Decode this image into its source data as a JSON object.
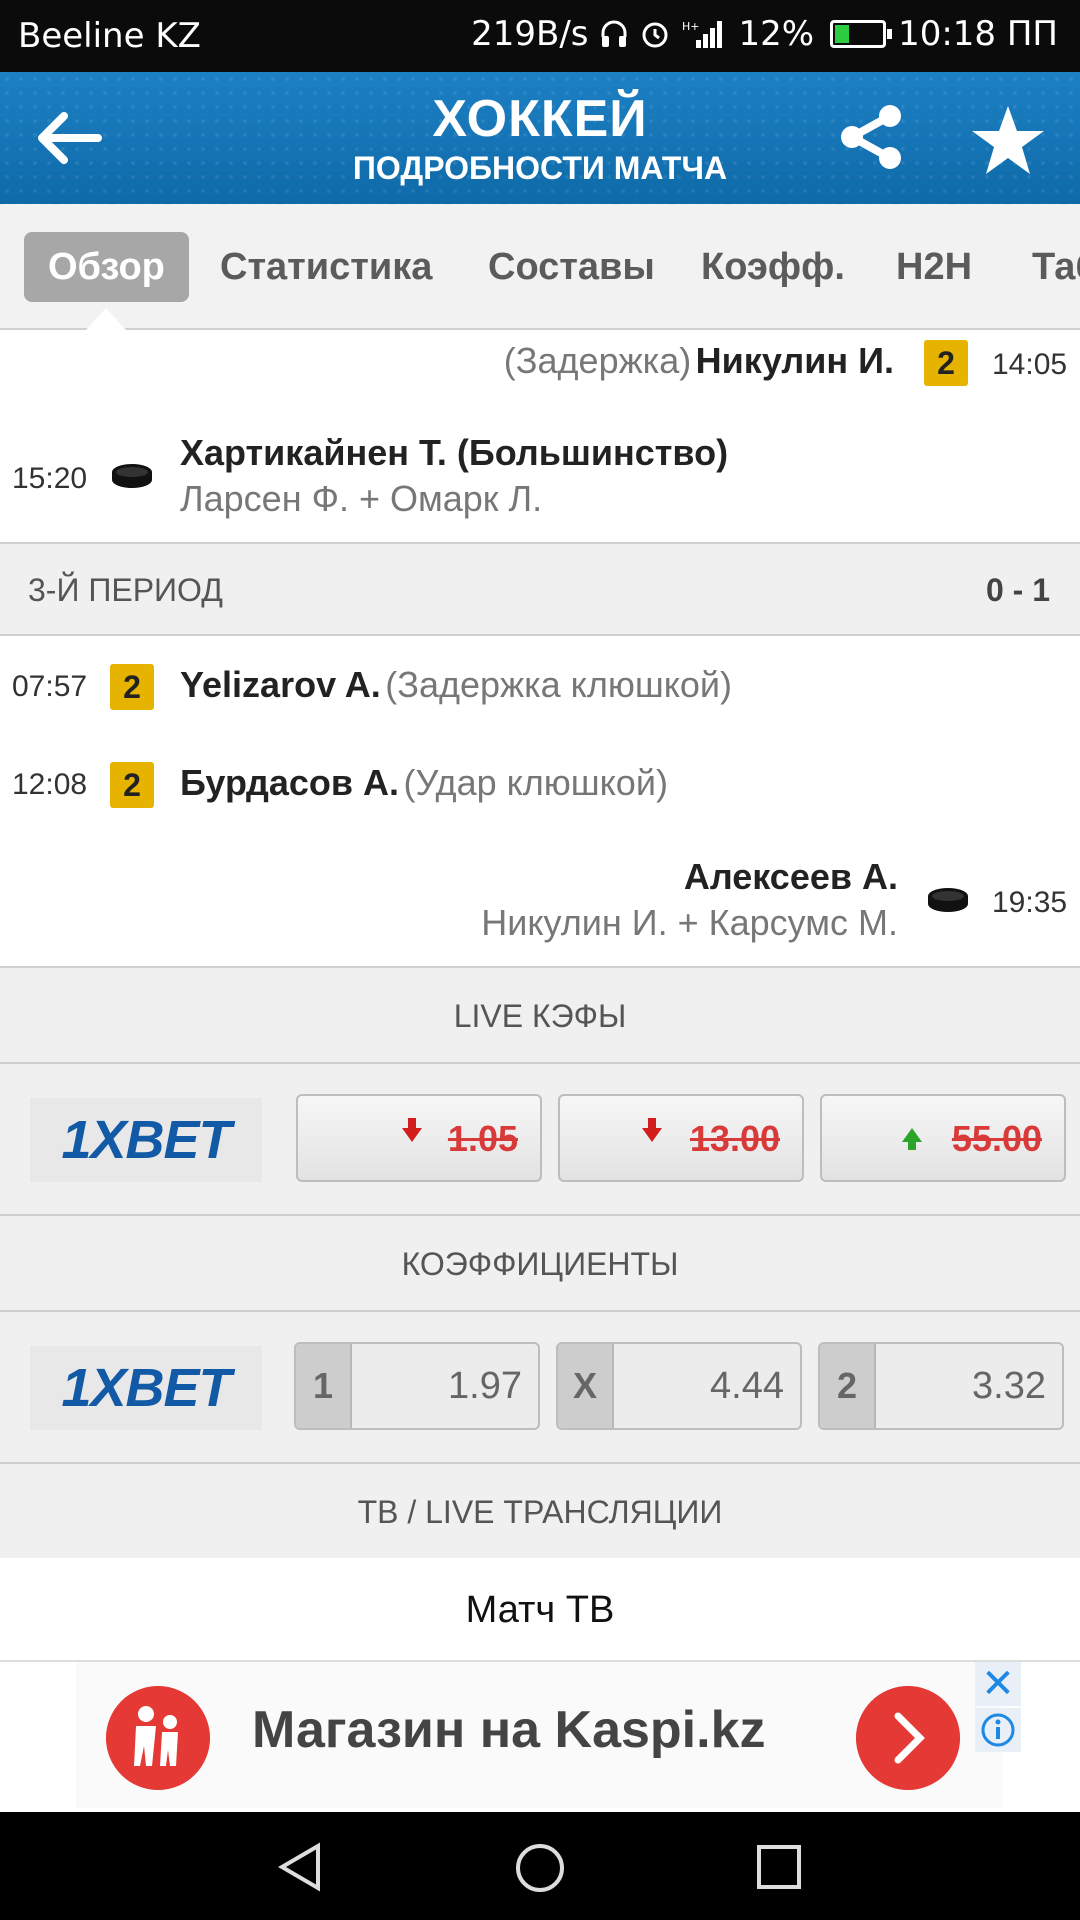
{
  "status_bar": {
    "carrier": "Beeline KZ",
    "speed": "219B/s",
    "battery_pct": "12%",
    "time": "10:18 ПП"
  },
  "app_bar": {
    "title": "ХОККЕЙ",
    "subtitle": "ПОДРОБНОСТИ МАТЧА"
  },
  "tabs": [
    {
      "label": "Обзор",
      "active": true
    },
    {
      "label": "Статистика"
    },
    {
      "label": "Составы"
    },
    {
      "label": "Коэфф."
    },
    {
      "label": "H2H"
    },
    {
      "label": "Таб"
    }
  ],
  "events_top": [
    {
      "detail": "(Задержка)",
      "player": "Никулин И.",
      "card": "2",
      "time": "14:05"
    },
    {
      "time": "15:20",
      "player": "Хартикайнен Т. (Большинство)",
      "assists": "Ларсен Ф. + Омарк Л."
    }
  ],
  "period3": {
    "label": "3-Й ПЕРИОД",
    "score": "0 - 1",
    "events": [
      {
        "time": "07:57",
        "card": "2",
        "player": "Yelizarov A.",
        "detail": "(Задержка клюшкой)"
      },
      {
        "time": "12:08",
        "card": "2",
        "player": "Бурдасов А.",
        "detail": "(Удар клюшкой)"
      },
      {
        "player": "Алексеев А.",
        "assists": "Никулин И. + Карсумс М.",
        "time": "19:35"
      }
    ]
  },
  "live_odds": {
    "header": "LIVE КЭФЫ",
    "bookmaker": "1XBET",
    "values": [
      {
        "value": "1.05",
        "trend": "down"
      },
      {
        "value": "13.00",
        "trend": "down"
      },
      {
        "value": "55.00",
        "trend": "up"
      }
    ]
  },
  "odds": {
    "header": "КОЭФФИЦИЕНТЫ",
    "bookmaker": "1XBET",
    "values": [
      {
        "key": "1",
        "value": "1.97"
      },
      {
        "key": "X",
        "value": "4.44"
      },
      {
        "key": "2",
        "value": "3.32"
      }
    ]
  },
  "tv": {
    "header": "ТВ / LIVE ТРАНСЛЯЦИИ",
    "channel": "Матч ТВ"
  },
  "ad": {
    "text": "Магазин на Kaspi.kz",
    "close": "✕"
  },
  "colors": {
    "header_blue": "#1670b0",
    "card_yellow": "#e6b300",
    "odds_red": "#d83a3a",
    "arrow_green": "#2aa52a",
    "ad_red": "#e53935"
  }
}
